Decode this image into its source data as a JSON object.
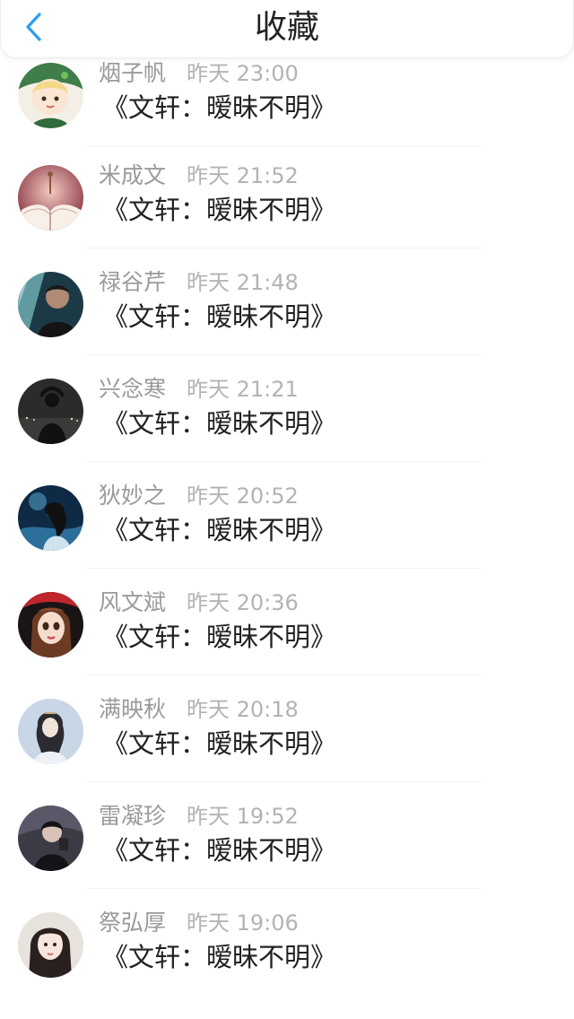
{
  "header": {
    "title": "收藏",
    "back_icon": "chevron-left-icon",
    "accent": "#2a9df4"
  },
  "items": [
    {
      "name": "烟子帆",
      "time": "昨天 23:00",
      "content": "《文轩：暧昧不明》"
    },
    {
      "name": "米成文",
      "time": "昨天 21:52",
      "content": "《文轩：暧昧不明》"
    },
    {
      "name": "禄谷芹",
      "time": "昨天 21:48",
      "content": "《文轩：暧昧不明》"
    },
    {
      "name": "兴念寒",
      "time": "昨天 21:21",
      "content": "《文轩：暧昧不明》"
    },
    {
      "name": "狄妙之",
      "time": "昨天 20:52",
      "content": "《文轩：暧昧不明》"
    },
    {
      "name": "风文斌",
      "time": "昨天 20:36",
      "content": "《文轩：暧昧不明》"
    },
    {
      "name": "满映秋",
      "time": "昨天 20:18",
      "content": "《文轩：暧昧不明》"
    },
    {
      "name": "雷凝珍",
      "time": "昨天 19:52",
      "content": "《文轩：暧昧不明》"
    },
    {
      "name": "祭弘厚",
      "time": "昨天 19:06",
      "content": "《文轩：暧昧不明》"
    }
  ]
}
